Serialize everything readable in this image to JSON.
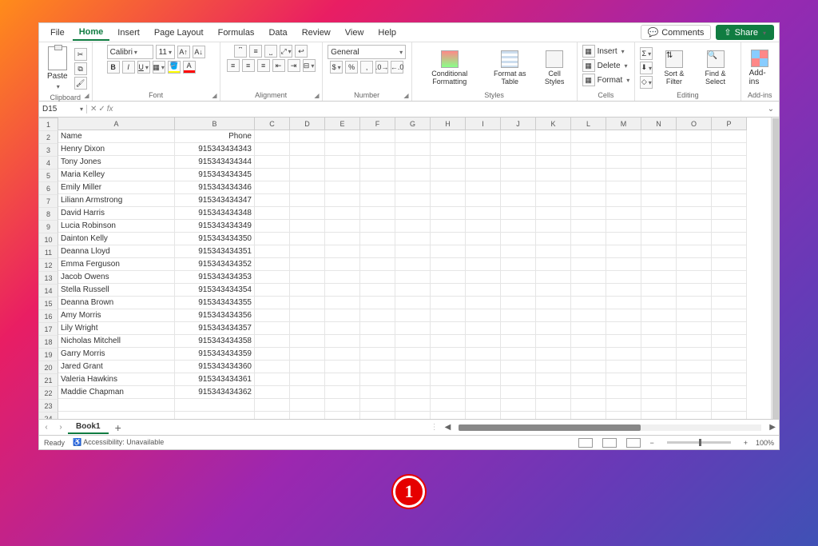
{
  "tabs": {
    "file": "File",
    "home": "Home",
    "insert": "Insert",
    "page_layout": "Page Layout",
    "formulas": "Formulas",
    "data": "Data",
    "review": "Review",
    "view": "View",
    "help": "Help"
  },
  "title_buttons": {
    "comments": "Comments",
    "share": "Share"
  },
  "ribbon": {
    "clipboard": {
      "label": "Clipboard",
      "paste": "Paste"
    },
    "font": {
      "label": "Font",
      "name": "Calibri",
      "size": "11"
    },
    "alignment": {
      "label": "Alignment"
    },
    "number": {
      "label": "Number",
      "format": "General"
    },
    "styles": {
      "label": "Styles",
      "cond": "Conditional Formatting",
      "fat": "Format as Table",
      "cs": "Cell Styles"
    },
    "cells": {
      "label": "Cells",
      "insert": "Insert",
      "delete": "Delete",
      "format": "Format"
    },
    "editing": {
      "label": "Editing",
      "sort": "Sort & Filter",
      "find": "Find & Select"
    },
    "addins": {
      "label": "Add-ins",
      "addins": "Add-ins"
    }
  },
  "namebox": "D15",
  "columns": [
    "A",
    "B",
    "C",
    "D",
    "E",
    "F",
    "G",
    "H",
    "I",
    "J",
    "K",
    "L",
    "M",
    "N",
    "O",
    "P"
  ],
  "row_count": 24,
  "headers": {
    "A": "Name",
    "B": "Phone"
  },
  "rows": [
    {
      "A": "Henry Dixon",
      "B": "915343434343"
    },
    {
      "A": "Tony Jones",
      "B": "915343434344"
    },
    {
      "A": "Maria Kelley",
      "B": "915343434345"
    },
    {
      "A": "Emily Miller",
      "B": "915343434346"
    },
    {
      "A": "Liliann Armstrong",
      "B": "915343434347"
    },
    {
      "A": "David Harris",
      "B": "915343434348"
    },
    {
      "A": "Lucia Robinson",
      "B": "915343434349"
    },
    {
      "A": "Dainton Kelly",
      "B": "915343434350"
    },
    {
      "A": "Deanna Lloyd",
      "B": "915343434351"
    },
    {
      "A": "Emma Ferguson",
      "B": "915343434352"
    },
    {
      "A": "Jacob Owens",
      "B": "915343434353"
    },
    {
      "A": "Stella Russell",
      "B": "915343434354"
    },
    {
      "A": "Deanna Brown",
      "B": "915343434355"
    },
    {
      "A": "Amy Morris",
      "B": "915343434356"
    },
    {
      "A": "Lily Wright",
      "B": "915343434357"
    },
    {
      "A": "Nicholas Mitchell",
      "B": "915343434358"
    },
    {
      "A": "Garry Morris",
      "B": "915343434359"
    },
    {
      "A": "Jared Grant",
      "B": "915343434360"
    },
    {
      "A": "Valeria Hawkins",
      "B": "915343434361"
    },
    {
      "A": "Maddie Chapman",
      "B": "915343434362"
    }
  ],
  "sheet": {
    "name": "Book1"
  },
  "status": {
    "ready": "Ready",
    "access": "Accessibility: Unavailable",
    "zoom": "100%"
  },
  "badge": "1"
}
